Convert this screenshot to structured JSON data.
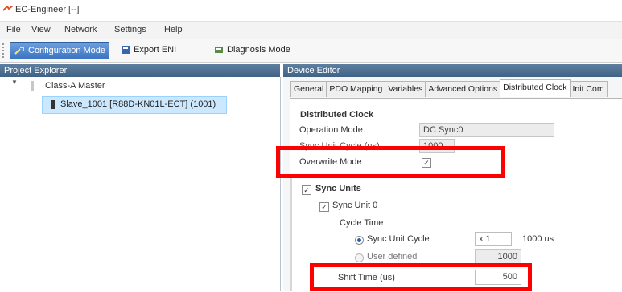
{
  "window": {
    "title": "EC-Engineer [--]",
    "logo_icon": "ec-logo-icon"
  },
  "menu": [
    "File",
    "View",
    "Network",
    "Settings",
    "Help"
  ],
  "toolbar": {
    "config_mode": "Configuration Mode",
    "export_eni": "Export ENI",
    "diagnosis_mode": "Diagnosis Mode"
  },
  "project_explorer": {
    "header": "Project Explorer",
    "master": "Class-A Master",
    "slave": "Slave_1001 [R88D-KN01L-ECT] (1001)"
  },
  "device_editor": {
    "header": "Device Editor",
    "tabs": [
      "General",
      "PDO Mapping",
      "Variables",
      "Advanced Options",
      "Distributed Clock",
      "Init Com"
    ],
    "active_tab": "Distributed Clock",
    "section_title": "Distributed Clock",
    "operation_mode_label": "Operation Mode",
    "operation_mode_value": "DC Sync0",
    "sync_unit_cycle_label": "Sync Unit Cycle (us)",
    "sync_unit_cycle_value": "1000",
    "overwrite_mode_label": "Overwrite Mode",
    "sync_units_label": "Sync Units",
    "sync_unit0_label": "Sync Unit 0",
    "cycle_time_label": "Cycle Time",
    "radio_sync_unit_cycle": "Sync Unit Cycle",
    "multiplier_value": "x 1",
    "sync_cycle_us": "1000 us",
    "radio_user_defined": "User defined",
    "user_defined_value": "1000",
    "shift_time_label": "Shift Time (us)",
    "shift_time_value": "500"
  },
  "colors": {
    "highlight_box": "#ff0000",
    "selection": "#cce8ff",
    "header": "#4a6d90"
  }
}
